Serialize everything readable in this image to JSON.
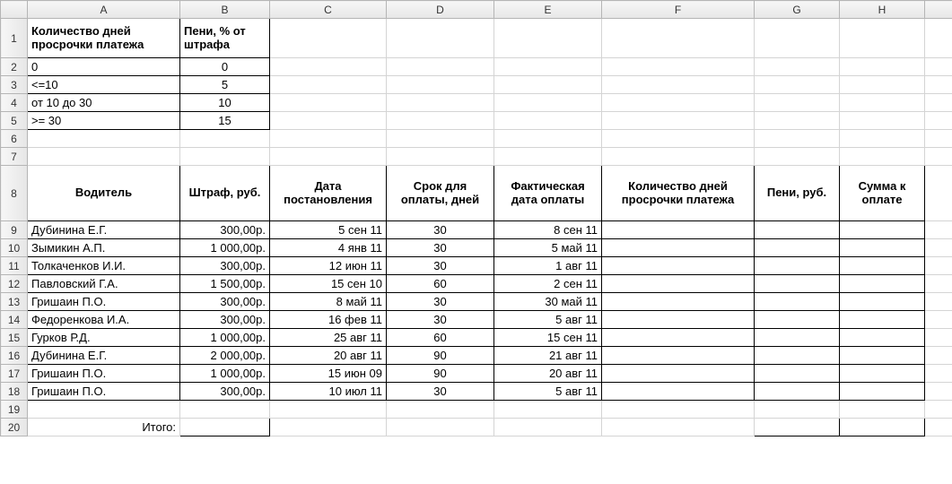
{
  "columns": [
    "A",
    "B",
    "C",
    "D",
    "E",
    "F",
    "G",
    "H"
  ],
  "row_labels": [
    "1",
    "2",
    "3",
    "4",
    "5",
    "6",
    "7",
    "8",
    "9",
    "10",
    "11",
    "12",
    "13",
    "14",
    "15",
    "16",
    "17",
    "18",
    "19",
    "20"
  ],
  "penalty_table": {
    "header_days": "Количество дней просрочки платежа",
    "header_pct": "Пени, % от штрафа",
    "rows": [
      {
        "days": "0",
        "pct": "0"
      },
      {
        "days": "<=10",
        "pct": "5"
      },
      {
        "days": "от 10 до 30",
        "pct": "10"
      },
      {
        "days": ">= 30",
        "pct": "15"
      }
    ]
  },
  "main_table": {
    "headers": {
      "driver": "Водитель",
      "fine": "Штраф, руб.",
      "decree": "Дата постановления",
      "deadline": "Срок для оплаты, дней",
      "paid": "Фактическая дата оплаты",
      "overdue": "Количество дней просрочки платежа",
      "peni": "Пени, руб.",
      "total": "Сумма к оплате"
    },
    "rows": [
      {
        "driver": "Дубинина Е.Г.",
        "fine": "300,00р.",
        "decree": "5 сен 11",
        "deadline": "30",
        "paid": "8 сен 11"
      },
      {
        "driver": "Зымикин А.П.",
        "fine": "1 000,00р.",
        "decree": "4 янв 11",
        "deadline": "30",
        "paid": "5 май 11"
      },
      {
        "driver": "Толкаченков И.И.",
        "fine": "300,00р.",
        "decree": "12 июн 11",
        "deadline": "30",
        "paid": "1 авг 11"
      },
      {
        "driver": "Павловский Г.А.",
        "fine": "1 500,00р.",
        "decree": "15 сен 10",
        "deadline": "60",
        "paid": "2 сен 11"
      },
      {
        "driver": "Гришаин П.О.",
        "fine": "300,00р.",
        "decree": "8 май 11",
        "deadline": "30",
        "paid": "30 май 11"
      },
      {
        "driver": "Федоренкова И.А.",
        "fine": "300,00р.",
        "decree": "16 фев 11",
        "deadline": "30",
        "paid": "5 авг 11"
      },
      {
        "driver": "Гурков Р.Д.",
        "fine": "1 000,00р.",
        "decree": "25 авг 11",
        "deadline": "60",
        "paid": "15 сен 11"
      },
      {
        "driver": "Дубинина Е.Г.",
        "fine": "2 000,00р.",
        "decree": "20 авг 11",
        "deadline": "90",
        "paid": "21 авг 11"
      },
      {
        "driver": "Гришаин П.О.",
        "fine": "1 000,00р.",
        "decree": "15 июн 09",
        "deadline": "90",
        "paid": "20 авг 11"
      },
      {
        "driver": "Гришаин П.О.",
        "fine": "300,00р.",
        "decree": "10 июл 11",
        "deadline": "30",
        "paid": "5 авг 11"
      }
    ],
    "total_label": "Итого:"
  }
}
